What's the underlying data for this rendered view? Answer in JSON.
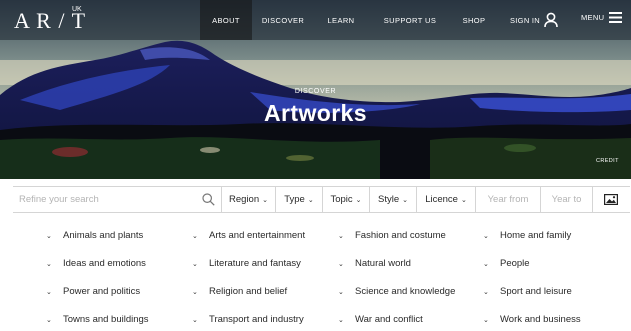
{
  "logo": {
    "mark": "A R / T",
    "suffix": "UK"
  },
  "nav": {
    "items": [
      {
        "label": "ABOUT",
        "active": true
      },
      {
        "label": "DISCOVER"
      },
      {
        "label": "LEARN"
      },
      {
        "label": "SUPPORT US"
      },
      {
        "label": "SHOP"
      }
    ],
    "signin_label": "SIGN IN",
    "menu_label": "MENU"
  },
  "hero": {
    "eyebrow": "DISCOVER",
    "title": "Artworks",
    "credit": "CREDIT"
  },
  "filters": {
    "search_placeholder": "Refine your search",
    "region": "Region",
    "type": "Type",
    "topic": "Topic",
    "style": "Style",
    "licence": "Licence",
    "year_from_placeholder": "Year from",
    "year_to_placeholder": "Year to"
  },
  "topics": {
    "items": [
      "Animals and plants",
      "Arts and entertainment",
      "Fashion and costume",
      "Home and family",
      "Ideas and emotions",
      "Literature and fantasy",
      "Natural world",
      "People",
      "Power and politics",
      "Religion and belief",
      "Science and knowledge",
      "Sport and leisure",
      "Towns and buildings",
      "Transport and industry",
      "War and conflict",
      "Work and business"
    ]
  },
  "colors": {
    "nav_active_bg": "#1a1a1a",
    "text": "#2a2a2a",
    "placeholder": "#b4b4b4",
    "border": "#d5d5d5"
  },
  "icons": [
    "search-icon",
    "user-icon",
    "hamburger-icon",
    "image-icon",
    "chevron-down-icon"
  ]
}
